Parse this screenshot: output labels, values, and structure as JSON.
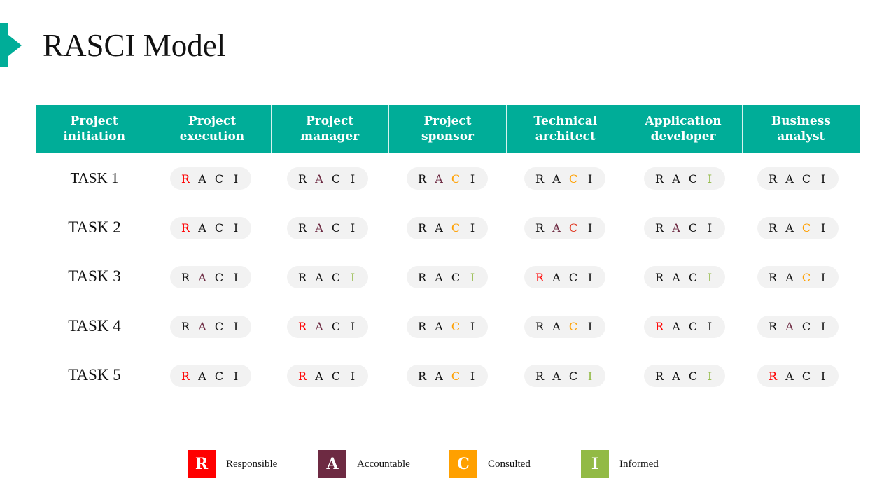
{
  "title": "RASCI Model",
  "colors": {
    "accent": "#00ad98",
    "R": "#ff0000",
    "A": "#6d2a42",
    "C": "#ffa000",
    "C_alt": "#e0341e",
    "I": "#92ba45",
    "inactive": "#111111"
  },
  "headers": [
    {
      "line1": "Project",
      "line2": "initiation"
    },
    {
      "line1": "Project",
      "line2": "execution"
    },
    {
      "line1": "Project",
      "line2": "manager"
    },
    {
      "line1": "Project",
      "line2": "sponsor"
    },
    {
      "line1": "Technical",
      "line2": "architect"
    },
    {
      "line1": "Application",
      "line2": "developer"
    },
    {
      "line1": "Business",
      "line2": "analyst"
    }
  ],
  "letters": [
    "R",
    "A",
    "C",
    "I"
  ],
  "tasks": [
    {
      "label": "TASK 1",
      "cells": [
        [
          "R"
        ],
        [
          "A"
        ],
        [
          "A",
          "C"
        ],
        [
          "C"
        ],
        [
          "I"
        ],
        []
      ]
    },
    {
      "label": "TASK 2",
      "cells": [
        [
          "R"
        ],
        [
          "A"
        ],
        [
          "C"
        ],
        [
          "A",
          "C_alt"
        ],
        [
          "A"
        ],
        [
          "C"
        ]
      ]
    },
    {
      "label": "TASK 3",
      "cells": [
        [
          "A"
        ],
        [
          "I"
        ],
        [
          "I"
        ],
        [
          "R"
        ],
        [
          "I"
        ],
        [
          "C"
        ]
      ]
    },
    {
      "label": "TASK 4",
      "cells": [
        [
          "A"
        ],
        [
          "R",
          "A"
        ],
        [
          "C"
        ],
        [
          "C"
        ],
        [
          "R"
        ],
        [
          "A"
        ]
      ]
    },
    {
      "label": "TASK 5",
      "cells": [
        [
          "R"
        ],
        [
          "R"
        ],
        [
          "C"
        ],
        [
          "I"
        ],
        [
          "I"
        ],
        [
          "R"
        ]
      ]
    }
  ],
  "legend": [
    {
      "letter": "R",
      "label": "Responsible",
      "color": "#ff0000"
    },
    {
      "letter": "A",
      "label": "Accountable",
      "color": "#6d2a42"
    },
    {
      "letter": "C",
      "label": "Consulted",
      "color": "#ffa000"
    },
    {
      "letter": "I",
      "label": "Informed",
      "color": "#92ba45"
    }
  ]
}
